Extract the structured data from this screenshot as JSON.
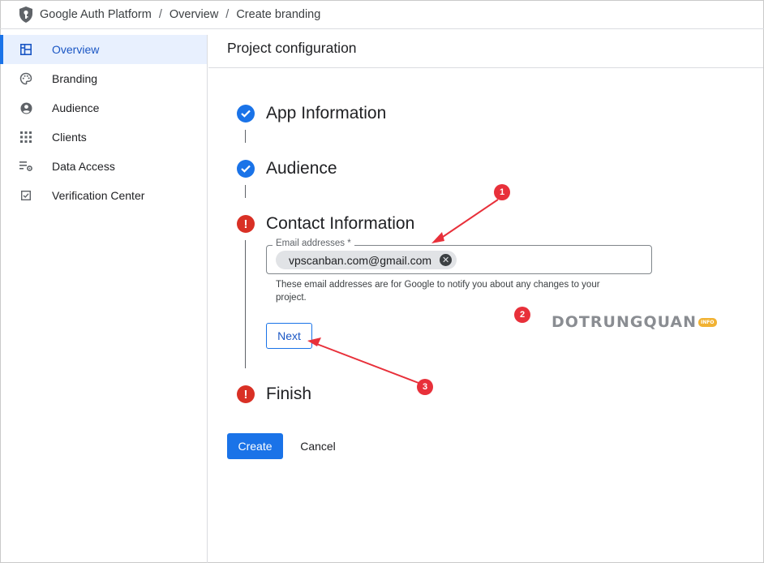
{
  "breadcrumb": {
    "items": [
      "Google Auth Platform",
      "Overview",
      "Create branding"
    ],
    "separator": "/"
  },
  "sidebar": {
    "items": [
      {
        "label": "Overview",
        "icon": "dashboard-icon",
        "active": true
      },
      {
        "label": "Branding",
        "icon": "palette-icon",
        "active": false
      },
      {
        "label": "Audience",
        "icon": "account-circle-icon",
        "active": false
      },
      {
        "label": "Clients",
        "icon": "apps-grid-icon",
        "active": false
      },
      {
        "label": "Data Access",
        "icon": "data-settings-icon",
        "active": false
      },
      {
        "label": "Verification Center",
        "icon": "checkbox-icon",
        "active": false
      }
    ]
  },
  "main": {
    "header": "Project configuration",
    "steps": [
      {
        "title": "App Information",
        "status": "complete"
      },
      {
        "title": "Audience",
        "status": "complete"
      },
      {
        "title": "Contact Information",
        "status": "error"
      },
      {
        "title": "Finish",
        "status": "error"
      }
    ],
    "email": {
      "label": "Email addresses *",
      "chip": "vpscanban.com@gmail.com",
      "helper": "These email addresses are for Google to notify you about any changes to your project."
    },
    "next_label": "Next",
    "create_label": "Create",
    "cancel_label": "Cancel"
  },
  "annotations": {
    "markers": [
      "1",
      "2",
      "3"
    ],
    "watermark": "DOTRUNGQUAN",
    "watermark_badge": "INFO"
  },
  "colors": {
    "accent": "#1a73e8",
    "error": "#d93025",
    "annotation": "#e8303a",
    "sidebar_active_bg": "#e8f0fe"
  }
}
